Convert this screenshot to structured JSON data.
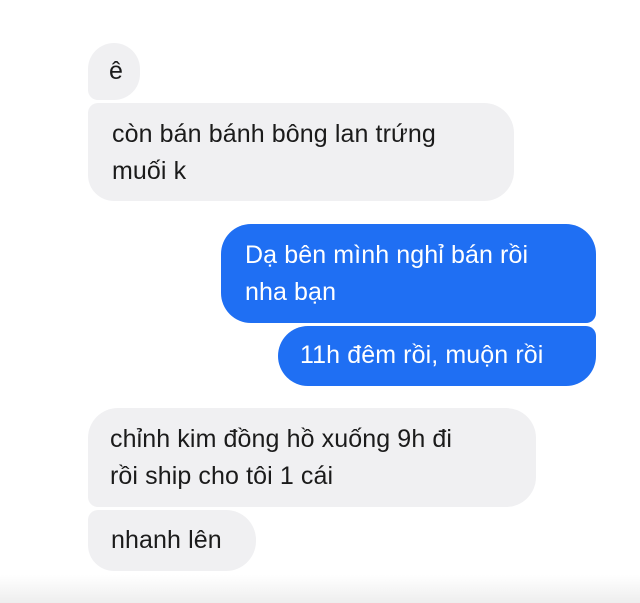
{
  "colors": {
    "incoming_bubble": "#f0f0f2",
    "outgoing_bubble": "#1f6ff3",
    "incoming_text": "#1b1b1b",
    "outgoing_text": "#ffffff"
  },
  "messages": [
    {
      "sender": "other",
      "lines": [
        "ê"
      ]
    },
    {
      "sender": "other",
      "lines": [
        "còn bán bánh bông lan trứng",
        "muối k"
      ]
    },
    {
      "sender": "me",
      "lines": [
        "Dạ bên mình nghỉ bán rồi",
        "nha bạn"
      ]
    },
    {
      "sender": "me",
      "lines": [
        "11h đêm rồi, muộn rồi"
      ]
    },
    {
      "sender": "other",
      "lines": [
        "chỉnh kim đồng hồ xuống 9h đi",
        "rồi ship cho tôi 1 cái"
      ]
    },
    {
      "sender": "other",
      "lines": [
        "nhanh lên"
      ]
    }
  ]
}
